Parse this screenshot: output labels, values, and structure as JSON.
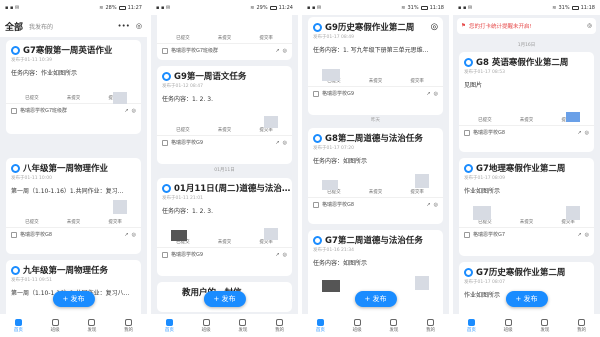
{
  "status": {
    "s1": {
      "time": "11:27",
      "battery": "28%"
    },
    "s2": {
      "time": "11:24",
      "battery": "29%"
    },
    "s3": {
      "time": "11:18",
      "battery": "31%"
    },
    "s4": {
      "time": "11:18",
      "battery": "31%"
    }
  },
  "screen1": {
    "tab_all": "全部",
    "tab_mine": "我发布的",
    "cards": [
      {
        "title": "G7寒假第一周英语作业",
        "sub": "发布于01-11 10:39",
        "body": "任务内容：作业如图所示",
        "done": "已提交",
        "undone": "未提交",
        "btn": "提交率",
        "school": "格瑞恩学校G7班级群"
      },
      {
        "title": "八年级第一周物理作业",
        "sub": "发布于01-11 10:00",
        "body": "第一周（1.10-1.16）1.共同作业：复习…",
        "done": "已提交",
        "undone": "未提交",
        "btn": "提交率",
        "school": "格瑞恩学校G8"
      },
      {
        "title": "九年级第一周物理任务",
        "sub": "发布于01-11 09:51",
        "body": "第一周（1.10-1.16）1.共同作业：复习八…",
        "school": "格瑞恩学校"
      }
    ],
    "publish": "+ 发布"
  },
  "screen2": {
    "top_school": "格瑞恩学校G7班级群",
    "cards": [
      {
        "title": "G9第一周语文任务",
        "sub": "发布于01-12 08:47",
        "body": "任务内容：1. 2. 3.",
        "done": "已提交",
        "undone": "未提交",
        "btn": "提交率",
        "school": "格瑞恩学校G9"
      },
      {
        "title": "01月11日(周二)道德与法治…",
        "sub": "发布于01-11 21:01",
        "body": "任务内容：1. 2. 3.",
        "done": "已提交",
        "undone": "未提交",
        "btn": "提交率",
        "school": "格瑞恩学校G9"
      },
      {
        "title": "教用户的一封信"
      }
    ],
    "date_sep": "01月11日",
    "publish": "+ 发布"
  },
  "screen3": {
    "cards": [
      {
        "title": "G9历史寒假作业第二周",
        "sub": "发布于01-17 08:49",
        "body": "任务内容：1. 写九年级下册第三单元思维…",
        "done": "已提交",
        "undone": "未提交",
        "btn": "提交率",
        "school": "格瑞恩学校G9"
      },
      {
        "title": "G8第二周道德与法治任务",
        "sub": "发布于01-17 07:20",
        "body": "任务内容：如图所示",
        "done": "已提交",
        "undone": "未提交",
        "btn": "提交率",
        "school": "格瑞恩学校G8"
      },
      {
        "title": "G7第二周道德与法治任务",
        "sub": "发布于01-16 21:34",
        "body": "任务内容：如图所示",
        "done": "已提交",
        "undone": "未提交",
        "btn": "提交率",
        "school": "格瑞恩学校G7班级群"
      }
    ],
    "date_sep": "昨天",
    "publish": "+ 发布"
  },
  "screen4": {
    "notice": "您的打卡统计提醒未开启!",
    "date_sep": "1月16日",
    "cards": [
      {
        "title": "G8 英语寒假作业第二周",
        "sub": "发布于01-17 08:53",
        "body": "见图片",
        "done": "已提交",
        "undone": "未提交",
        "btn": "提交率",
        "school": "格瑞恩学校G8"
      },
      {
        "title": "G7地理寒假作业第二周",
        "sub": "发布于01-17 08:09",
        "body": "作业如图所示",
        "done": "已提交",
        "undone": "未提交",
        "btn": "提交率",
        "school": "格瑞恩学校G7"
      },
      {
        "title": "G7历史寒假作业第二周",
        "sub": "发布于01-17 08:07",
        "body": "作业如图所示",
        "school": "格瑞恩学校"
      }
    ],
    "publish": "+ 发布"
  },
  "nav": [
    "首页",
    "班级",
    "发现",
    "我的"
  ]
}
